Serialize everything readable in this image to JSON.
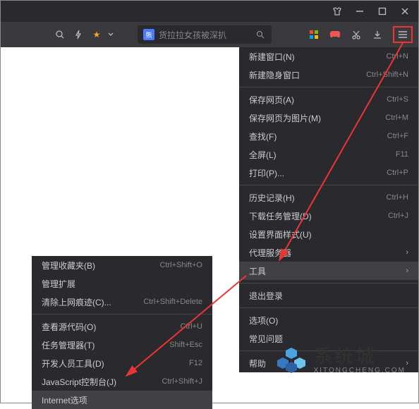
{
  "titlebar": {
    "icons": [
      "tshirt",
      "minimize",
      "maximize",
      "close"
    ]
  },
  "toolbar": {
    "search_placeholder": "货拉拉女孩被深扒",
    "baidu_glyph": "熊"
  },
  "main_menu": {
    "items": [
      {
        "label": "新建窗口(N)",
        "shortcut": "Ctrl+N"
      },
      {
        "label": "新建隐身窗口",
        "shortcut": "Ctrl+Shift+N"
      },
      {
        "sep": true
      },
      {
        "label": "保存网页(A)",
        "shortcut": "Ctrl+S"
      },
      {
        "label": "保存网页为图片(M)",
        "shortcut": "Ctrl+M"
      },
      {
        "label": "查找(F)",
        "shortcut": "Ctrl+F"
      },
      {
        "label": "全屏(L)",
        "shortcut": "F11"
      },
      {
        "label": "打印(P)...",
        "shortcut": "Ctrl+P"
      },
      {
        "sep": true
      },
      {
        "label": "历史记录(H)",
        "shortcut": "Ctrl+H"
      },
      {
        "label": "下载任务管理(D)",
        "shortcut": "Ctrl+J"
      },
      {
        "label": "设置界面样式(U)",
        "shortcut": ""
      },
      {
        "label": "代理服务器",
        "submenu": true
      },
      {
        "label": "工具",
        "submenu": true,
        "highlight": true,
        "redbox": true
      },
      {
        "sep": true
      },
      {
        "label": "退出登录",
        "shortcut": ""
      },
      {
        "sep": true
      },
      {
        "label": "选项(O)",
        "shortcut": ""
      },
      {
        "label": "常见问题",
        "shortcut": ""
      },
      {
        "sep": true
      },
      {
        "label": "帮助",
        "submenu": true
      }
    ]
  },
  "sub_menu": {
    "items": [
      {
        "label": "管理收藏夹(B)",
        "shortcut": "Ctrl+Shift+O"
      },
      {
        "label": "管理扩展",
        "shortcut": ""
      },
      {
        "label": "清除上网痕迹(C)...",
        "shortcut": "Ctrl+Shift+Delete"
      },
      {
        "sep": true
      },
      {
        "label": "查看源代码(O)",
        "shortcut": "Ctrl+U"
      },
      {
        "label": "任务管理器(T)",
        "shortcut": "Shift+Esc"
      },
      {
        "label": "开发人员工具(D)",
        "shortcut": "F12"
      },
      {
        "label": "JavaScript控制台(J)",
        "shortcut": "Ctrl+Shift+J"
      },
      {
        "label": "Internet选项",
        "shortcut": "",
        "highlight": true,
        "redbox": true
      }
    ]
  },
  "watermark": {
    "big": "系统城",
    "small": "XITONGCHENG.COM"
  }
}
